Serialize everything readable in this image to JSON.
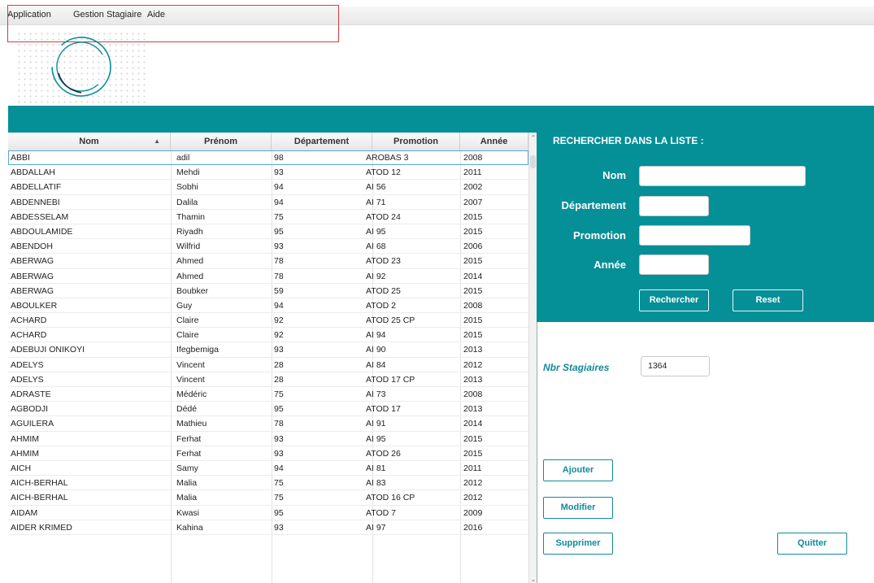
{
  "menu": {
    "items": [
      "Application",
      "Gestion Stagiaire",
      "Aide"
    ]
  },
  "colors": {
    "accent": "#058f97",
    "label_accent": "#138a9a",
    "annotation_outline": "#d93c3c"
  },
  "icons": {
    "logo": "logo-icon",
    "sort": "sort-ascending-icon",
    "scroll_up": "chevron-up-icon",
    "scroll_down": "chevron-down-icon"
  },
  "table": {
    "columns": [
      "Nom",
      "Prénom",
      "Département",
      "Promotion",
      "Année"
    ],
    "sorted_column": "Nom",
    "rows": [
      [
        "ABBI",
        "adil",
        "98",
        "AROBAS 3",
        "2008"
      ],
      [
        "ABDALLAH",
        "Mehdi",
        "93",
        "ATOD 12",
        "2011"
      ],
      [
        "ABDELLATIF",
        "Sobhi",
        "94",
        "AI 56",
        "2002"
      ],
      [
        "ABDENNEBI",
        "Dalila",
        "94",
        "AI 71",
        "2007"
      ],
      [
        "ABDESSELAM",
        "Thamin",
        "75",
        "ATOD 24",
        "2015"
      ],
      [
        "ABDOULAMIDE",
        "Riyadh",
        "95",
        "AI 95",
        "2015"
      ],
      [
        "ABENDOH",
        "Wilfrid",
        "93",
        "AI 68",
        "2006"
      ],
      [
        "ABERWAG",
        "Ahmed",
        "78",
        "ATOD 23",
        "2015"
      ],
      [
        "ABERWAG",
        "Ahmed",
        "78",
        "AI 92",
        "2014"
      ],
      [
        "ABERWAG",
        "Boubker",
        "59",
        "ATOD 25",
        "2015"
      ],
      [
        "ABOULKER",
        "Guy",
        "94",
        "ATOD 2",
        "2008"
      ],
      [
        "ACHARD",
        "Claire",
        "92",
        "ATOD 25 CP",
        "2015"
      ],
      [
        "ACHARD",
        "Claire",
        "92",
        "AI 94",
        "2015"
      ],
      [
        "ADEBUJI ONIKOYI",
        "Ifegbemiga",
        "93",
        "AI 90",
        "2013"
      ],
      [
        "ADELYS",
        "Vincent",
        "28",
        "AI 84",
        "2012"
      ],
      [
        "ADELYS",
        "Vincent",
        "28",
        "ATOD 17 CP",
        "2013"
      ],
      [
        "ADRASTE",
        "Médéric",
        "75",
        "AI 73",
        "2008"
      ],
      [
        "AGBODJI",
        "Dédé",
        "95",
        "ATOD 17",
        "2013"
      ],
      [
        "AGUILERA",
        "Mathieu",
        "78",
        "AI 91",
        "2014"
      ],
      [
        "AHMIM",
        "Ferhat",
        "93",
        "AI 95",
        "2015"
      ],
      [
        "AHMIM",
        "Ferhat",
        "93",
        "ATOD 26",
        "2015"
      ],
      [
        "AICH",
        "Samy",
        "94",
        "AI 81",
        "2011"
      ],
      [
        "AICH-BERHAL",
        "Malia",
        "75",
        "AI 83",
        "2012"
      ],
      [
        "AICH-BERHAL",
        "Malia",
        "75",
        "ATOD 16 CP",
        "2012"
      ],
      [
        "AIDAM",
        "Kwasi",
        "95",
        "ATOD 7",
        "2009"
      ],
      [
        "AIDER KRIMED",
        "Kahina",
        "93",
        "AI 97",
        "2016"
      ]
    ]
  },
  "search": {
    "title": "RECHERCHER DANS LA LISTE :",
    "nom_label": "Nom",
    "departement_label": "Département",
    "promotion_label": "Promotion",
    "annee_label": "Année",
    "nom_value": "",
    "departement_value": "",
    "promotion_value": "",
    "annee_value": "",
    "search_button": "Rechercher",
    "reset_button": "Reset"
  },
  "stats": {
    "nbr_label": "Nbr Stagiaires",
    "nbr_value": "1364"
  },
  "actions": {
    "ajouter": "Ajouter",
    "modifier": "Modifier",
    "supprimer": "Supprimer",
    "quitter": "Quitter"
  }
}
